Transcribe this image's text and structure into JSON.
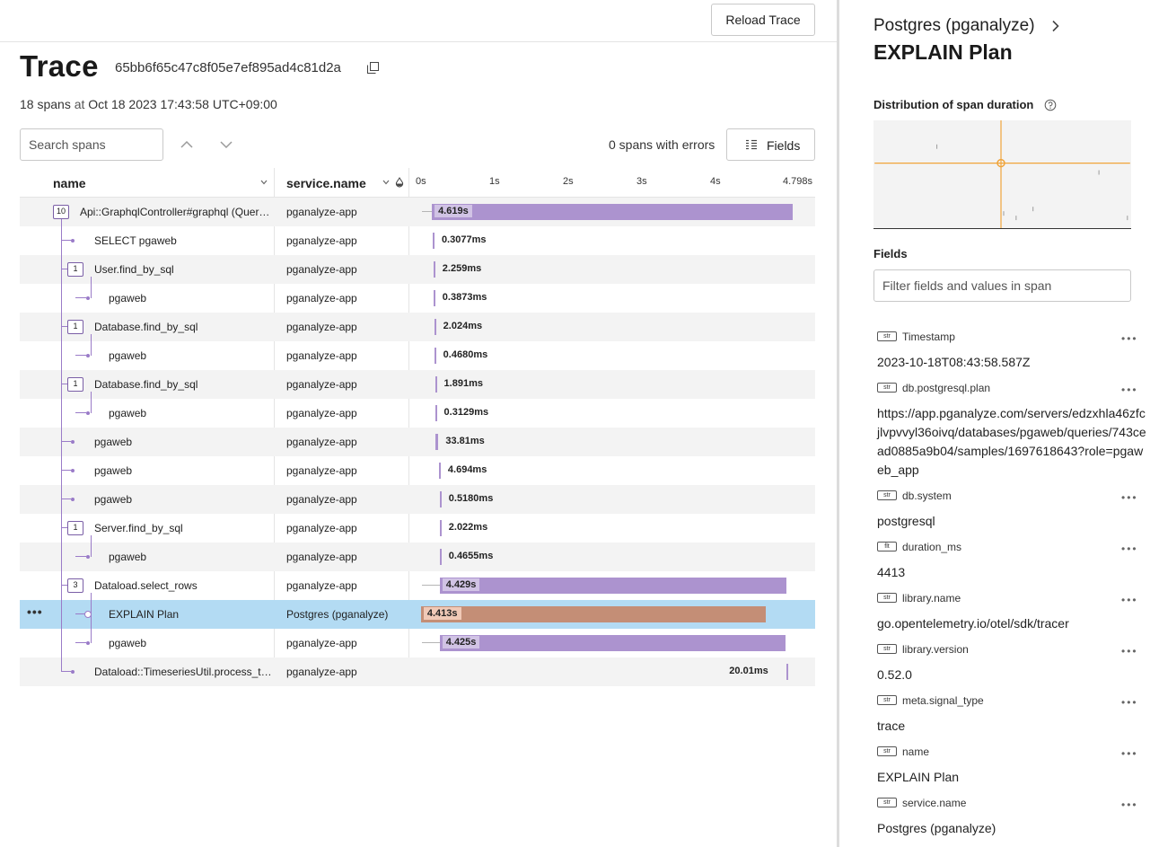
{
  "toolbar": {
    "reload_label": "Reload Trace"
  },
  "trace": {
    "title": "Trace",
    "id": "65bb6f65c47c8f05e7ef895ad4c81d2a",
    "span_count": "18 spans",
    "at_label": "at",
    "timestamp": "Oct 18 2023 17:43:58 UTC+09:00"
  },
  "search": {
    "placeholder": "Search spans"
  },
  "errors_label": "0 spans with errors",
  "fields_button": "Fields",
  "table": {
    "col_name": "name",
    "col_service": "service.name",
    "ticks": [
      "0s",
      "1s",
      "2s",
      "3s",
      "4s",
      "4.798s"
    ],
    "rows": [
      {
        "name": "Api::GraphqlController#graphql (Quer…",
        "service": "pganalyze-app",
        "badge": "10",
        "depth": 0,
        "duration": "4.619s",
        "start": 0.15,
        "width": 4.619
      },
      {
        "name": "SELECT pgaweb",
        "service": "pganalyze-app",
        "badge": "",
        "depth": 1,
        "duration": "0.3077ms",
        "start": 0.16,
        "width": 0.0003
      },
      {
        "name": "User.find_by_sql",
        "service": "pganalyze-app",
        "badge": "1",
        "depth": 1,
        "duration": "2.259ms",
        "start": 0.17,
        "width": 0.0023
      },
      {
        "name": "pgaweb",
        "service": "pganalyze-app",
        "badge": "",
        "depth": 2,
        "duration": "0.3873ms",
        "start": 0.17,
        "width": 0.0004
      },
      {
        "name": "Database.find_by_sql",
        "service": "pganalyze-app",
        "badge": "1",
        "depth": 1,
        "duration": "2.024ms",
        "start": 0.18,
        "width": 0.002
      },
      {
        "name": "pgaweb",
        "service": "pganalyze-app",
        "badge": "",
        "depth": 2,
        "duration": "0.4680ms",
        "start": 0.18,
        "width": 0.0005
      },
      {
        "name": "Database.find_by_sql",
        "service": "pganalyze-app",
        "badge": "1",
        "depth": 1,
        "duration": "1.891ms",
        "start": 0.19,
        "width": 0.0019
      },
      {
        "name": "pgaweb",
        "service": "pganalyze-app",
        "badge": "",
        "depth": 2,
        "duration": "0.3129ms",
        "start": 0.19,
        "width": 0.0003
      },
      {
        "name": "pgaweb",
        "service": "pganalyze-app",
        "badge": "",
        "depth": 1,
        "duration": "33.81ms",
        "start": 0.2,
        "width": 0.0338
      },
      {
        "name": "pgaweb",
        "service": "pganalyze-app",
        "badge": "",
        "depth": 1,
        "duration": "4.694ms",
        "start": 0.24,
        "width": 0.0047
      },
      {
        "name": "pgaweb",
        "service": "pganalyze-app",
        "badge": "",
        "depth": 1,
        "duration": "0.5180ms",
        "start": 0.25,
        "width": 0.0005
      },
      {
        "name": "Server.find_by_sql",
        "service": "pganalyze-app",
        "badge": "1",
        "depth": 1,
        "duration": "2.022ms",
        "start": 0.25,
        "width": 0.002
      },
      {
        "name": "pgaweb",
        "service": "pganalyze-app",
        "badge": "",
        "depth": 2,
        "duration": "0.4655ms",
        "start": 0.25,
        "width": 0.0005
      },
      {
        "name": "Dataload.select_rows",
        "service": "pganalyze-app",
        "badge": "3",
        "depth": 1,
        "duration": "4.429s",
        "start": 0.25,
        "width": 4.429
      },
      {
        "name": "EXPLAIN Plan",
        "service": "Postgres (pganalyze)",
        "badge": "",
        "depth": 2,
        "duration": "4.413s",
        "start": 0.01,
        "width": 4.413,
        "selected": true
      },
      {
        "name": "pgaweb",
        "service": "pganalyze-app",
        "badge": "",
        "depth": 2,
        "duration": "4.425s",
        "start": 0.25,
        "width": 4.425
      },
      {
        "name": "Dataload::TimeseriesUtil.process_t…",
        "service": "pganalyze-app",
        "badge": "",
        "depth": 1,
        "duration": "20.01ms",
        "start": 4.68,
        "width": 0.02
      }
    ]
  },
  "panel": {
    "service": "Postgres (pganalyze)",
    "title": "EXPLAIN Plan",
    "dist_title": "Distribution of span duration",
    "fields_title": "Fields",
    "filter_placeholder": "Filter fields and values in span",
    "fields": [
      {
        "type": "str",
        "key": "Timestamp",
        "value": "2023-10-18T08:43:58.587Z"
      },
      {
        "type": "str",
        "key": "db.postgresql.plan",
        "value": "https://app.pganalyze.com/servers/edzxhla46zfcjlvpvvyl36oivq/databases/pgaweb/queries/743cead0885a9b04/samples/1697618643?role=pgaweb_app"
      },
      {
        "type": "str",
        "key": "db.system",
        "value": "postgresql"
      },
      {
        "type": "flt",
        "key": "duration_ms",
        "value": "4413"
      },
      {
        "type": "str",
        "key": "library.name",
        "value": "go.opentelemetry.io/otel/sdk/tracer"
      },
      {
        "type": "str",
        "key": "library.version",
        "value": "0.52.0"
      },
      {
        "type": "str",
        "key": "meta.signal_type",
        "value": "trace"
      },
      {
        "type": "str",
        "key": "name",
        "value": "EXPLAIN Plan"
      },
      {
        "type": "str",
        "key": "service.name",
        "value": "Postgres (pganalyze)"
      }
    ]
  },
  "colors": {
    "accent_purple": "#ac93cf",
    "selected_orange": "#c48e76",
    "selected_row": "#b3dbf3",
    "chart_crosshair": "#f0a43a"
  }
}
